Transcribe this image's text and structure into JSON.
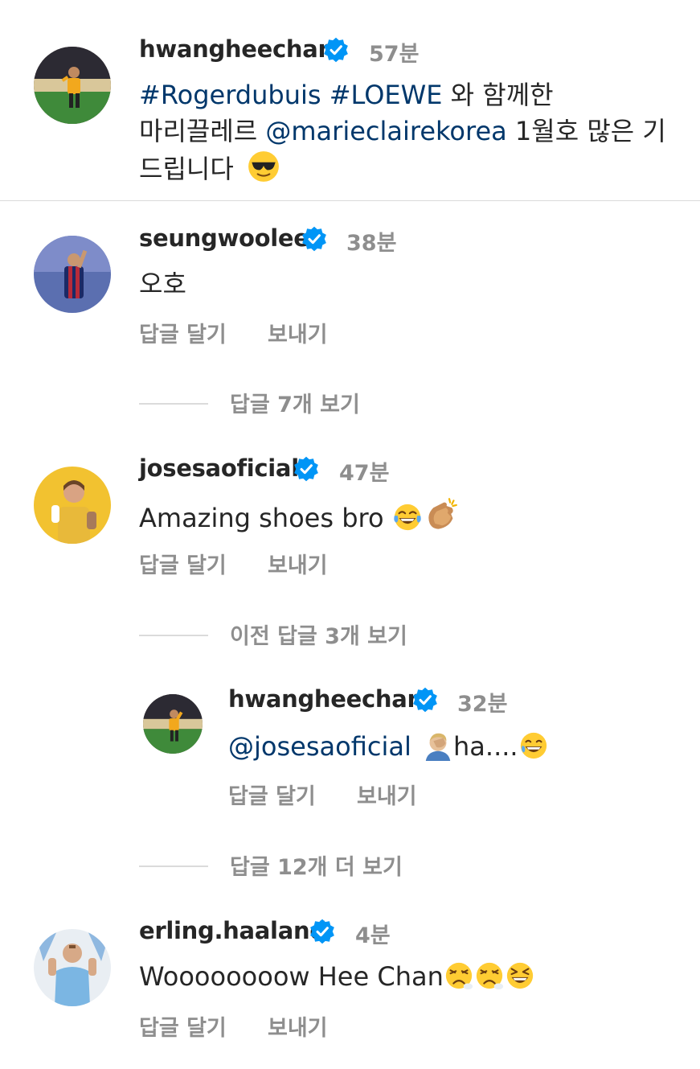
{
  "post": {
    "username": "hwangheechan",
    "time": "57분",
    "caption_line1_tag1": "#Rogerdubuis",
    "caption_line1_tag2": "#LOEWE",
    "caption_line1_text": "와 함께한",
    "caption_line2_text1": "마리끌레르",
    "caption_line2_mention": "@marieclairekorea",
    "caption_line2_text2": "1월호 많은 기",
    "caption_line3_text": "드립니다",
    "emoji": "sunglasses-face"
  },
  "comments": [
    {
      "username": "seungwoolee",
      "time": "38분",
      "text": "오호",
      "reply_label": "답글 달기",
      "send_label": "보내기",
      "view_replies": "답글 7개 보기"
    },
    {
      "username": "josesaoficial",
      "time": "47분",
      "text": "Amazing shoes bro",
      "emojis": [
        "tears-of-joy",
        "clapping-hands"
      ],
      "reply_label": "답글 달기",
      "send_label": "보내기",
      "view_previous": "이전 답글 3개 보기",
      "reply": {
        "username": "hwangheechan",
        "time": "32분",
        "mention": "@josesaoficial",
        "text": "ha....",
        "emojis": [
          "facepalm",
          "grinning-sweat"
        ],
        "reply_label": "답글 달기",
        "send_label": "보내기"
      },
      "view_more": "답글 12개 더 보기"
    },
    {
      "username": "erling.haaland",
      "time": "4분",
      "text": "Woooooooow Hee Chan",
      "emojis": [
        "tired-face",
        "tired-face",
        "laughing-face"
      ],
      "reply_label": "답글 달기",
      "send_label": "보내기"
    }
  ],
  "colors": {
    "link": "#00376b",
    "verified": "#0095f6",
    "secondary": "#8e8e8e",
    "text": "#262626"
  }
}
